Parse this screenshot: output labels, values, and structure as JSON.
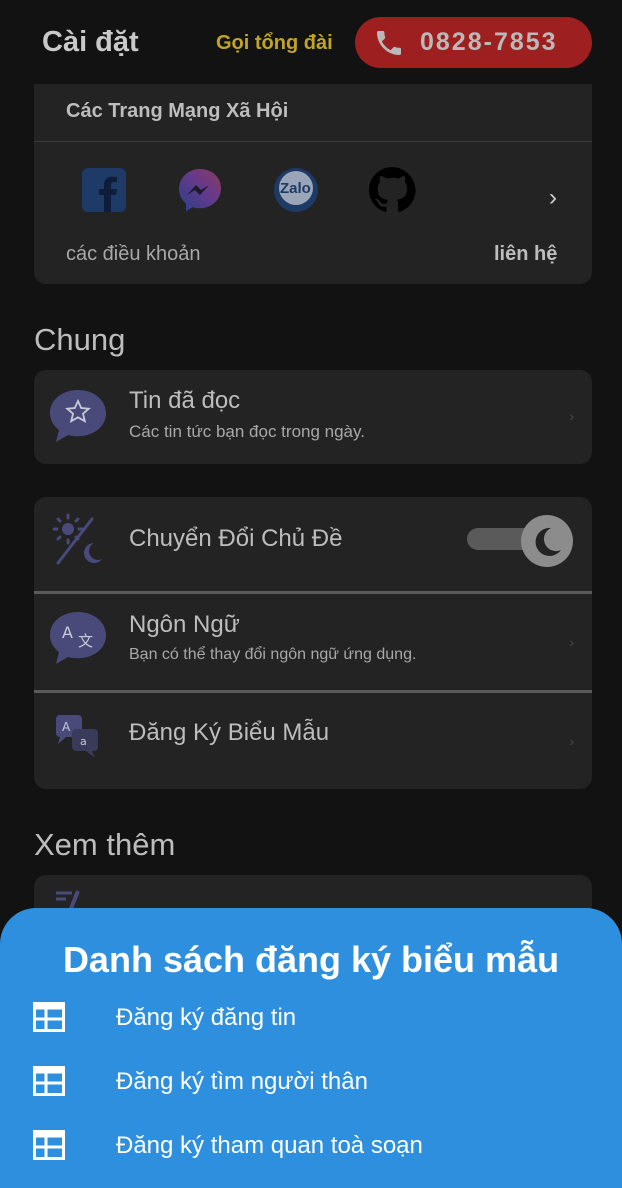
{
  "header": {
    "title": "Cài đặt",
    "call_label": "Gọi tổng đài",
    "phone_number": "0828-7853"
  },
  "social": {
    "title": "Các Trang Mạng Xã Hội",
    "icons": [
      "facebook-icon",
      "messenger-icon",
      "zalo-icon",
      "github-icon"
    ],
    "zalo_text": "Zalo",
    "terms": "các điều khoản",
    "contact": "liên hệ"
  },
  "general": {
    "section_title": "Chung",
    "read_news": {
      "title": "Tin đã đọc",
      "subtitle": "Các tin tức bạn đọc trong ngày."
    },
    "theme": {
      "title": "Chuyển Đổi Chủ Đề",
      "dark_mode_on": true
    },
    "language": {
      "title": "Ngôn Ngữ",
      "subtitle": "Bạn có thể thay đổi ngôn ngữ ứng dụng."
    },
    "form": {
      "title": "Đăng Ký Biểu Mẫu"
    }
  },
  "more": {
    "section_title": "Xem thêm"
  },
  "sheet": {
    "title": "Danh sách đăng ký biểu mẫu",
    "items": [
      {
        "label": "Đăng ký đăng tin"
      },
      {
        "label": "Đăng ký tìm người thân"
      },
      {
        "label": "Đăng ký tham quan toà soạn"
      }
    ]
  },
  "colors": {
    "accent_blue": "#2e8fde",
    "call_red": "#9e1f1f",
    "call_label_gold": "#c2a424",
    "icon_purple": "#5a5a8c"
  }
}
